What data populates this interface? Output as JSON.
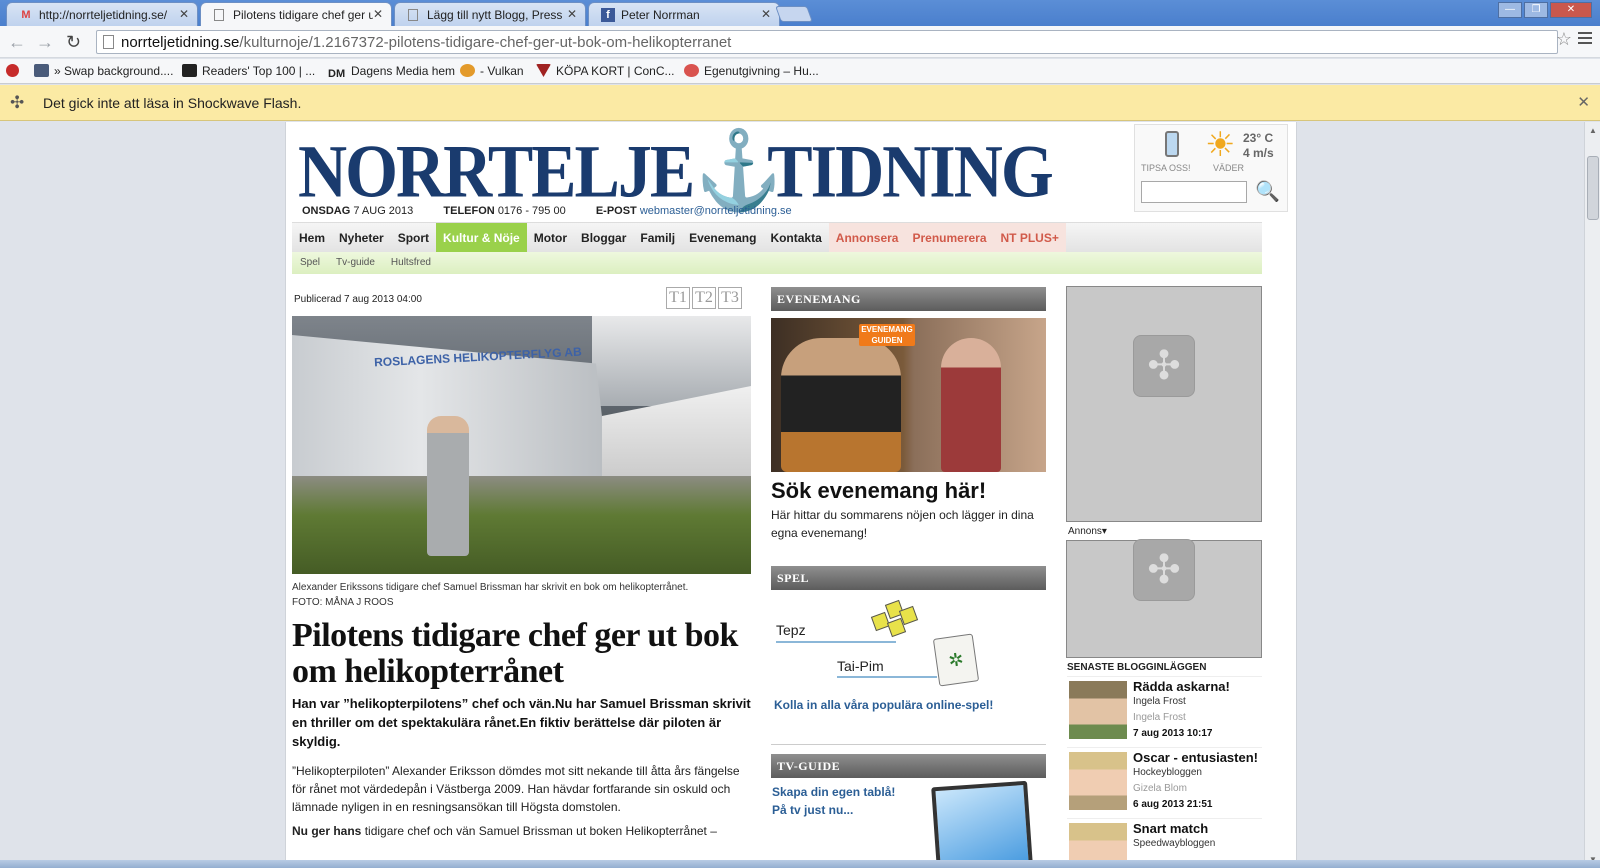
{
  "tabs": [
    {
      "icon": "gmail-icon",
      "title": "http://norrteljetidning.se/",
      "active": false
    },
    {
      "icon": "page-icon",
      "title": "Pilotens tidigare chef ger ut",
      "active": true
    },
    {
      "icon": "page-icon",
      "title": "Lägg till nytt Blogg, Press",
      "active": false
    },
    {
      "icon": "facebook-icon",
      "title": "Peter Norrman",
      "active": false
    }
  ],
  "address": {
    "host": "norrteljetidning.se",
    "path": "/kulturnoje/1.2167372-pilotens-tidigare-chef-ger-ut-bok-om-helikopterranet"
  },
  "bookmarks": [
    "» Swap background....",
    "Readers' Top 100 | ...",
    "Dagens Media hem",
    "- Vulkan",
    "KÖPA KORT | ConC...",
    "Egenutgivning – Hu..."
  ],
  "infobar": {
    "message": "Det gick inte att läsa in Shockwave Flash."
  },
  "masthead": {
    "logo_left": "NORRTELJE",
    "logo_right": "TIDNING",
    "day": "ONSDAG",
    "date": "7 AUG 2013",
    "phone_label": "TELEFON",
    "phone": "0176 - 795 00",
    "email_label": "E-POST",
    "email": "webmaster@norrteljetidning.se",
    "tipsa": "TIPSA OSS!",
    "vader": "VÄDER",
    "temperature": "23° C",
    "wind": "4 m/s"
  },
  "nav": [
    "Hem",
    "Nyheter",
    "Sport",
    "Kultur & Nöje",
    "Motor",
    "Bloggar",
    "Familj",
    "Evenemang",
    "Kontakta",
    "Annonsera",
    "Prenumerera",
    "NT PLUS+"
  ],
  "subnav": [
    "Spel",
    "Tv-guide",
    "Hultsfred"
  ],
  "article": {
    "published": "Publicerad 7 aug 2013 04:00",
    "t1": "T1",
    "t2": "T2",
    "t3": "T3",
    "hero_sign": "ROSLAGENS HELIKOPTERFLYG AB",
    "caption": "Alexander Erikssons tidigare chef Samuel Brissman har skrivit en bok om helikopterrånet.",
    "photo_credit": "FOTO: MÅNA J ROOS",
    "headline": "Pilotens tidigare chef ger ut bok om helikopterrånet",
    "lead": "Han var ”helikopterpilotens” chef och vän.Nu har Samuel Brissman skrivit en thriller om det spektakulära rånet.En fiktiv berättelse där piloten är skyldig.",
    "body1": "”Helikopterpiloten” Alexander Eriksson dömdes mot sitt nekande till åtta års fängelse för rånet mot värdedepån i Västberga 2009. Han hävdar fortfarande sin oskuld och lämnade nyligen in en resningsansökan till Högsta domstolen.",
    "body2_bold": "Nu ger hans",
    "body2": "tidigare chef och vän Samuel Brissman ut boken Helikopterrånet –"
  },
  "middle": {
    "evenemang_header": "EVENEMANG",
    "evenemang_badge": "EVENEMANG GUIDEN",
    "evenemang_title": "Sök evenemang här!",
    "evenemang_text": "Här hittar du sommarens nöjen och lägger in dina egna evenemang!",
    "spel_header": "SPEL",
    "tepz": "Tepz",
    "taipim": "Tai-Pim",
    "spel_link": "Kolla in alla våra populära online-spel!",
    "tv_header": "TV-GUIDE",
    "tv_link1": "Skapa din egen tablå!",
    "tv_link2": "På tv just nu..."
  },
  "right": {
    "annons": "Annons▾",
    "blog_header": "SENASTE BLOGGINLÄGGEN",
    "blogs": [
      {
        "title": "Rädda askarna!",
        "blog": "Ingela Frost",
        "author": "Ingela Frost",
        "date": "7 aug 2013 10:17"
      },
      {
        "title": "Oscar - entusiasten!",
        "blog": "Hockeybloggen",
        "author": "Gizela Blom",
        "date": "6 aug 2013 21:51"
      },
      {
        "title": "Snart match",
        "blog": "Speedwaybloggen",
        "author": "",
        "date": ""
      }
    ]
  }
}
